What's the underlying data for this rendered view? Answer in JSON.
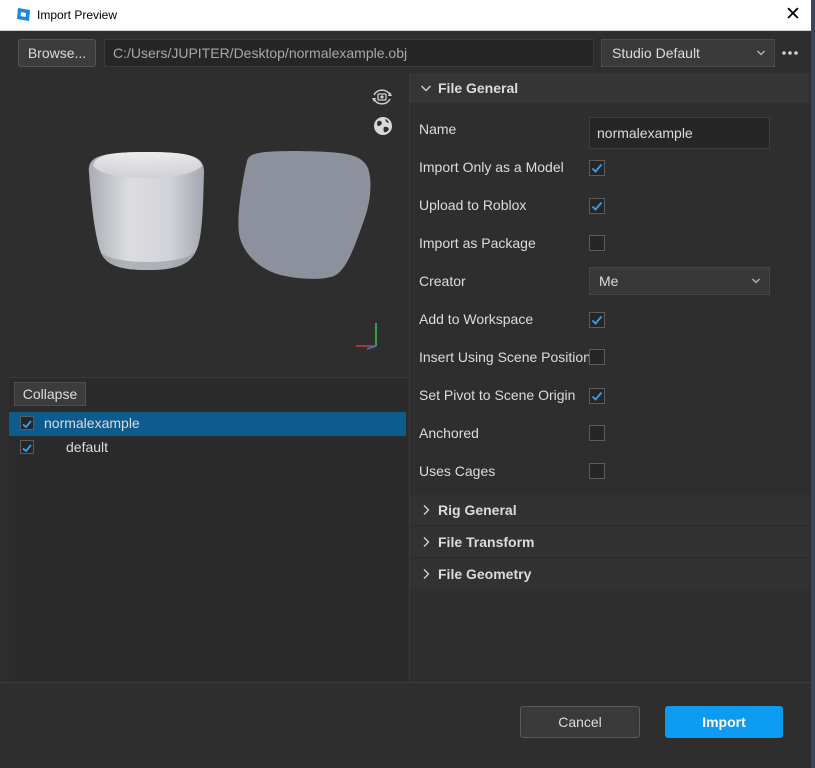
{
  "window": {
    "title": "Import Preview",
    "close_glyph": "✕"
  },
  "toolbar": {
    "browse_label": "Browse...",
    "file_path": "C:/Users/JUPITER/Desktop/normalexample.obj",
    "preset_value": "Studio Default",
    "more_icon": "more-horizontal-icon"
  },
  "viewport": {
    "icons": [
      "camera-rotate-icon",
      "globe-icon",
      "axis-gizmo-icon"
    ]
  },
  "tree": {
    "collapse_label": "Collapse",
    "items": [
      {
        "label": "normalexample",
        "checked": true,
        "selected": true
      },
      {
        "label": "default",
        "checked": true,
        "selected": false
      }
    ]
  },
  "properties": {
    "file_general": {
      "header": "File General",
      "expanded": true,
      "name_label": "Name",
      "name_value": "normalexample",
      "import_only_model_label": "Import Only as a Model",
      "import_only_model": true,
      "upload_label": "Upload to Roblox",
      "upload": true,
      "package_label": "Import as Package",
      "package": false,
      "creator_label": "Creator",
      "creator_value": "Me",
      "workspace_label": "Add to Workspace",
      "workspace": true,
      "scene_position_label": "Insert Using Scene Position",
      "scene_position": false,
      "pivot_label": "Set Pivot to Scene Origin",
      "pivot": true,
      "anchored_label": "Anchored",
      "anchored": false,
      "cages_label": "Uses Cages",
      "cages": false
    },
    "rig_general": {
      "header": "Rig General",
      "expanded": false
    },
    "file_transform": {
      "header": "File Transform",
      "expanded": false
    },
    "file_geometry": {
      "header": "File Geometry",
      "expanded": false
    }
  },
  "footer": {
    "cancel_label": "Cancel",
    "import_label": "Import"
  },
  "colors": {
    "accent": "#0d9bf2",
    "selection": "#0e5b90",
    "check": "#2ea3f2",
    "background": "#2e2e2e",
    "mesh": "#d4d5da",
    "mesh_shadow": "#8d919e"
  }
}
